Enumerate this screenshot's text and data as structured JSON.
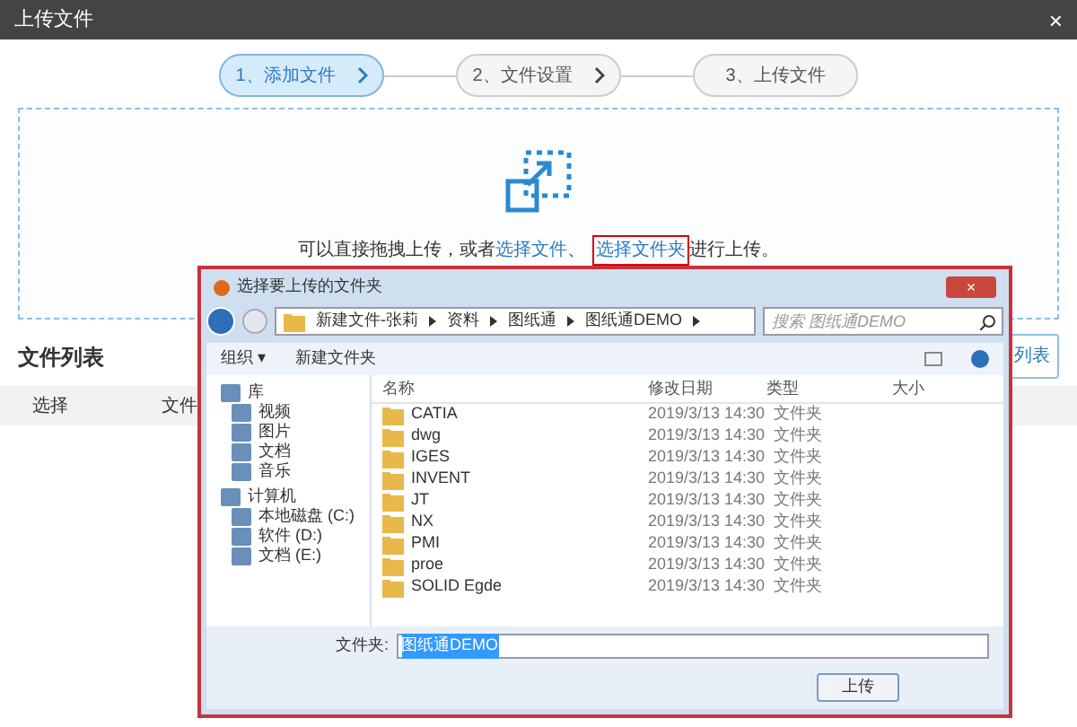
{
  "window": {
    "title": "上传文件",
    "close": "×"
  },
  "steps": [
    {
      "label": "1、添加文件",
      "selected": true,
      "arrow": true
    },
    {
      "label": "2、文件设置",
      "selected": false,
      "arrow": true
    },
    {
      "label": "3、上传文件",
      "selected": false,
      "arrow": false
    }
  ],
  "drop_zone": {
    "text": "可以直接拖拽上传，或者",
    "link_file": "选择文件",
    "sep": "、",
    "link_folder": "选择文件夹",
    "suffix": "进行上传。"
  },
  "file_list": {
    "title": "文件列表",
    "button": "列表",
    "columns": [
      "选择",
      "文件"
    ]
  },
  "dialog": {
    "title": "选择要上传的文件夹",
    "close": "×",
    "breadcrumb": [
      "新建文件-张莉",
      "资料",
      "图纸通",
      "图纸通DEMO"
    ],
    "search": {
      "placeholder": "搜索 图纸通DEMO"
    },
    "toolbar": [
      "组织 ▾",
      "新建文件夹"
    ],
    "nav": [
      {
        "label": "库",
        "children": [
          {
            "label": "视频"
          },
          {
            "label": "图片"
          },
          {
            "label": "文档"
          },
          {
            "label": "音乐"
          }
        ]
      },
      {
        "label": "计算机",
        "children": [
          {
            "label": "本地磁盘 (C:)"
          },
          {
            "label": "软件 (D:)"
          },
          {
            "label": "文档 (E:)"
          }
        ]
      }
    ],
    "columns": [
      "名称",
      "修改日期",
      "类型",
      "大小"
    ],
    "rows": [
      {
        "name": "CATIA",
        "date": "2019/3/13 14:30",
        "type": "文件夹"
      },
      {
        "name": "dwg",
        "date": "2019/3/13 14:30",
        "type": "文件夹"
      },
      {
        "name": "IGES",
        "date": "2019/3/13 14:30",
        "type": "文件夹"
      },
      {
        "name": "INVENT",
        "date": "2019/3/13 14:30",
        "type": "文件夹"
      },
      {
        "name": "JT",
        "date": "2019/3/13 14:30",
        "type": "文件夹"
      },
      {
        "name": "NX",
        "date": "2019/3/13 14:30",
        "type": "文件夹"
      },
      {
        "name": "PMI",
        "date": "2019/3/13 14:30",
        "type": "文件夹"
      },
      {
        "name": "proe",
        "date": "2019/3/13 14:30",
        "type": "文件夹"
      },
      {
        "name": "SOLID Egde",
        "date": "2019/3/13 14:30",
        "type": "文件夹"
      }
    ],
    "folder_label": "文件夹:",
    "folder_value": "图纸通DEMO",
    "ok_button": "上传"
  }
}
